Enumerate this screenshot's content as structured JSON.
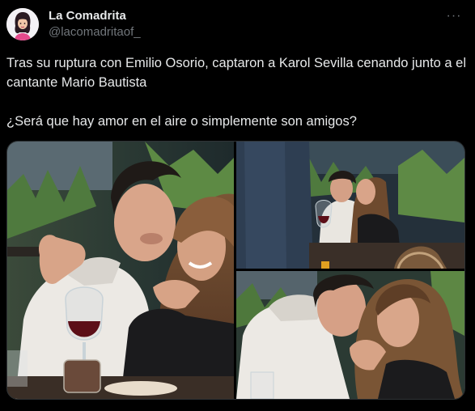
{
  "tweet": {
    "author_name": "La Comadrita",
    "author_handle": "@lacomadritaof_",
    "more_icon": "more-horizontal-icon",
    "more_label": "···",
    "text": "Tras su ruptura con Emilio Osorio, captaron a Karol Sevilla cenando junto a el cantante Mario Bautista\n\n¿Será que hay amor en el aire o simplemente son amigos?"
  },
  "colors": {
    "background": "#000000",
    "primary_text": "#e7e9ea",
    "secondary_text": "#71767b",
    "border": "#2f3336"
  }
}
